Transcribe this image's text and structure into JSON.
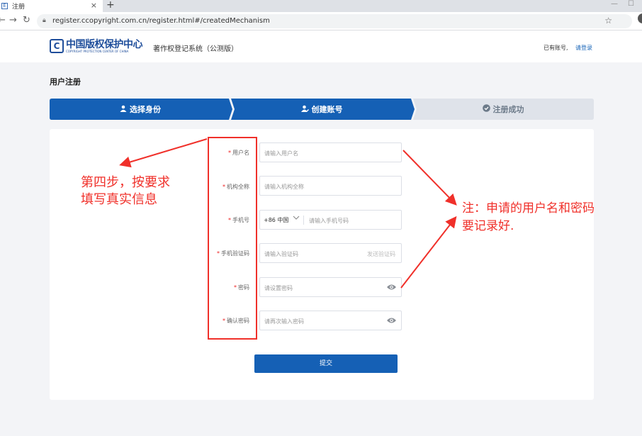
{
  "browser": {
    "tab_title": "注册",
    "tab_favicon": "E",
    "new_tab": "+",
    "close_tab": "×",
    "url": "register.ccopyright.com.cn/register.html#/createdMechanism"
  },
  "site": {
    "logo_mark": "C",
    "logo_cn": "中国版权保护中心",
    "logo_en": "COPYRIGHT PROTECTION CENTER OF CHINA",
    "system_name": "著作权登记系统（公测版）",
    "account_question": "已有账号,",
    "login_link": "请登录"
  },
  "page_title": "用户注册",
  "steps": [
    {
      "label": "选择身份",
      "icon": "user-icon",
      "state": "active"
    },
    {
      "label": "创建账号",
      "icon": "user-edit-icon",
      "state": "active"
    },
    {
      "label": "注册成功",
      "icon": "check-circle-icon",
      "state": "pending"
    }
  ],
  "form": {
    "username": {
      "label": "用户名",
      "placeholder": "请输入用户名"
    },
    "org_name": {
      "label": "机构全称",
      "placeholder": "请输入机构全称"
    },
    "phone": {
      "label": "手机号",
      "country_code": "+86 中国",
      "placeholder": "请输入手机号码"
    },
    "sms_code": {
      "label": "手机验证码",
      "placeholder": "请输入验证码",
      "send_label": "发送验证码"
    },
    "password": {
      "label": "密码",
      "placeholder": "请设置密码"
    },
    "confirm_password": {
      "label": "确认密码",
      "placeholder": "请再次输入密码"
    },
    "required_mark": "*",
    "submit_label": "提交"
  },
  "annotations": {
    "left_note": [
      "第四步，按要求",
      "填写真实信息"
    ],
    "right_note": [
      "注：申请的用户名和密码",
      "要记录好."
    ]
  },
  "colors": {
    "primary": "#1560b5",
    "step_active": "#1560b5",
    "step_pending": "#dfe3ea",
    "annotation_red": "#f0302a"
  }
}
